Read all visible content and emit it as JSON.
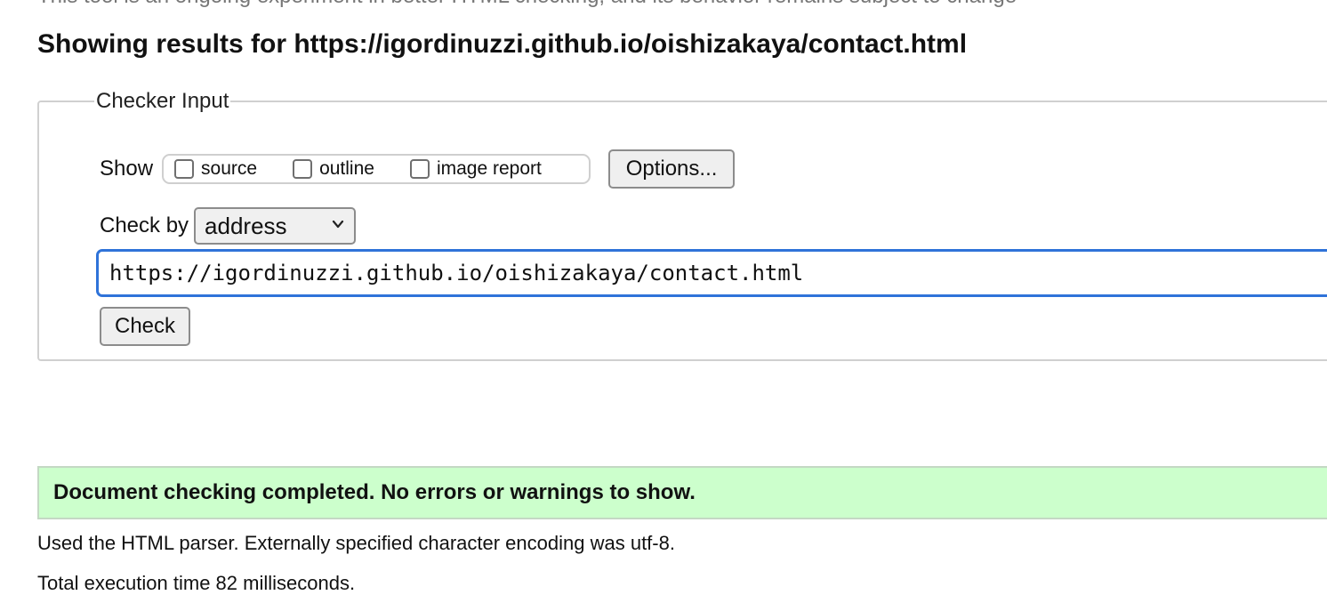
{
  "top_note": "This tool is an ongoing experiment in better HTML checking, and its behavior remains subject to change",
  "results_heading": "Showing results for https://igordinuzzi.github.io/oishizakaya/contact.html",
  "checker": {
    "legend": "Checker Input",
    "show_label": "Show",
    "show_options": [
      {
        "label": "source",
        "checked": false
      },
      {
        "label": "outline",
        "checked": false
      },
      {
        "label": "image report",
        "checked": false
      }
    ],
    "options_button": "Options...",
    "check_by_label": "Check by",
    "check_by_value": "address",
    "url_value": "https://igordinuzzi.github.io/oishizakaya/contact.html",
    "check_button": "Check"
  },
  "result": {
    "message": "Document checking completed. No errors or warnings to show.",
    "parser_info": "Used the HTML parser. Externally specified character encoding was utf-8.",
    "execution_time": "Total execution time 82 milliseconds."
  },
  "colors": {
    "success_bg": "#ccffcc",
    "input_focus_border": "#2f73d9"
  },
  "icons": {
    "select_arrow": "chevron-down-icon"
  }
}
